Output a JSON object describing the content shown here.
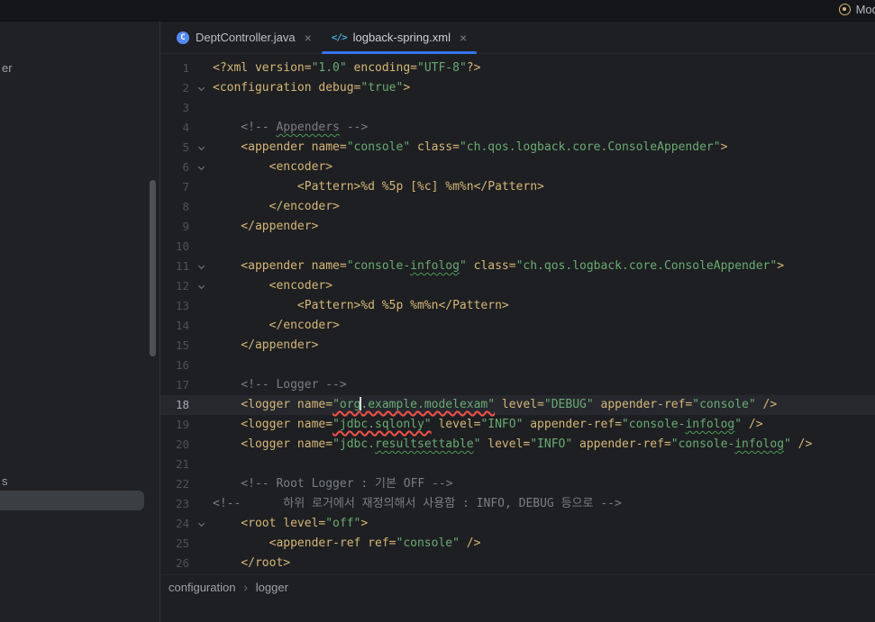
{
  "titlebar": {
    "model_label": "Model"
  },
  "tabs": [
    {
      "label": "DeptController.java",
      "icon": "java-class-icon",
      "close_label": "×",
      "active": false
    },
    {
      "label": "logback-spring.xml",
      "icon": "xml-file-icon",
      "close_label": "×",
      "active": true
    }
  ],
  "icon_glyphs": {
    "java-class-icon": "C",
    "xml-file-icon": "</>"
  },
  "sidebar": {
    "fragment_top": "er",
    "fragment_bottom": "s"
  },
  "breadcrumbs": {
    "items": [
      "configuration",
      "logger"
    ],
    "separator": "›"
  },
  "editor": {
    "lines": [
      {
        "n": 1,
        "segs": [
          [
            "t",
            "<?xml version="
          ],
          [
            "v",
            "\"1.0\""
          ],
          [
            "t",
            " encoding="
          ],
          [
            "v",
            "\"UTF-8\""
          ],
          [
            "t",
            "?>"
          ]
        ]
      },
      {
        "n": 2,
        "fold": true,
        "segs": [
          [
            "t",
            "<configuration debug="
          ],
          [
            "v",
            "\"true\""
          ],
          [
            "t",
            ">"
          ]
        ]
      },
      {
        "n": 3,
        "segs": []
      },
      {
        "n": 4,
        "segs": [
          [
            "c",
            "    <!-- "
          ],
          [
            "c typo",
            "Appenders"
          ],
          [
            "c",
            " -->"
          ]
        ]
      },
      {
        "n": 5,
        "fold": true,
        "segs": [
          [
            "t",
            "    <appender name="
          ],
          [
            "v",
            "\"console\""
          ],
          [
            "t",
            " class="
          ],
          [
            "v",
            "\"ch.qos.logback.core.ConsoleAppender\""
          ],
          [
            "t",
            ">"
          ]
        ]
      },
      {
        "n": 6,
        "fold": true,
        "segs": [
          [
            "t",
            "        <encoder>"
          ]
        ]
      },
      {
        "n": 7,
        "segs": [
          [
            "t",
            "            <Pattern>%d %5p [%c] %m%n</Pattern>"
          ]
        ]
      },
      {
        "n": 8,
        "segs": [
          [
            "t",
            "        </encoder>"
          ]
        ]
      },
      {
        "n": 9,
        "segs": [
          [
            "t",
            "    </appender>"
          ]
        ]
      },
      {
        "n": 10,
        "segs": []
      },
      {
        "n": 11,
        "fold": true,
        "segs": [
          [
            "t",
            "    <appender name="
          ],
          [
            "v",
            "\"console-"
          ],
          [
            "v typo",
            "infolog"
          ],
          [
            "v",
            "\""
          ],
          [
            "t",
            " class="
          ],
          [
            "v",
            "\"ch.qos.logback.core.ConsoleAppender\""
          ],
          [
            "t",
            ">"
          ]
        ]
      },
      {
        "n": 12,
        "fold": true,
        "segs": [
          [
            "t",
            "        <encoder>"
          ]
        ]
      },
      {
        "n": 13,
        "segs": [
          [
            "t",
            "            <Pattern>%d %5p %m%n</Pattern>"
          ]
        ]
      },
      {
        "n": 14,
        "segs": [
          [
            "t",
            "        </encoder>"
          ]
        ]
      },
      {
        "n": 15,
        "segs": [
          [
            "t",
            "    </appender>"
          ]
        ]
      },
      {
        "n": 16,
        "segs": []
      },
      {
        "n": 17,
        "segs": [
          [
            "c",
            "    <!-- Logger -->"
          ]
        ]
      },
      {
        "n": 18,
        "current": true,
        "segs": [
          [
            "t",
            "    <logger name="
          ],
          [
            "v err",
            "\"org"
          ],
          [
            "caret",
            ""
          ],
          [
            "v err",
            ".example.modelexam\""
          ],
          [
            "t",
            " level="
          ],
          [
            "v",
            "\"DEBUG\""
          ],
          [
            "t",
            " appender-ref="
          ],
          [
            "v",
            "\"console\""
          ],
          [
            "t",
            " />"
          ]
        ]
      },
      {
        "n": 19,
        "segs": [
          [
            "t",
            "    <logger name="
          ],
          [
            "v err",
            "\"jdbc.sqlonly\""
          ],
          [
            "t",
            " level="
          ],
          [
            "v",
            "\"INFO\""
          ],
          [
            "t",
            " appender-ref="
          ],
          [
            "v",
            "\"console-"
          ],
          [
            "v typo",
            "infolog"
          ],
          [
            "v",
            "\""
          ],
          [
            "t",
            " />"
          ]
        ]
      },
      {
        "n": 20,
        "segs": [
          [
            "t",
            "    <logger name="
          ],
          [
            "v",
            "\"jdbc."
          ],
          [
            "v typo",
            "resultsettable"
          ],
          [
            "v",
            "\""
          ],
          [
            "t",
            " level="
          ],
          [
            "v",
            "\"INFO\""
          ],
          [
            "t",
            " appender-ref="
          ],
          [
            "v",
            "\"console-"
          ],
          [
            "v typo",
            "infolog"
          ],
          [
            "v",
            "\""
          ],
          [
            "t",
            " />"
          ]
        ]
      },
      {
        "n": 21,
        "segs": []
      },
      {
        "n": 22,
        "segs": [
          [
            "c",
            "    <!-- Root Logger : 기본 OFF -->"
          ]
        ]
      },
      {
        "n": 23,
        "segs": [
          [
            "c",
            "<!--      하위 로거에서 재정의해서 사용함 : INFO, DEBUG 등으로 -->"
          ]
        ]
      },
      {
        "n": 24,
        "fold": true,
        "segs": [
          [
            "t",
            "    <root level="
          ],
          [
            "v",
            "\"off\""
          ],
          [
            "t",
            ">"
          ]
        ]
      },
      {
        "n": 25,
        "segs": [
          [
            "t",
            "        <appender-ref ref="
          ],
          [
            "v",
            "\"console\""
          ],
          [
            "t",
            " />"
          ]
        ]
      },
      {
        "n": 26,
        "segs": [
          [
            "t",
            "    </root>"
          ]
        ]
      }
    ]
  },
  "colors": {
    "accent": "#3574f0",
    "tag": "#d5b778",
    "value": "#6aab73",
    "comment": "#7a7e85",
    "error_underline": "#f55249",
    "typo_underline": "#4c9a55",
    "current_line": "#26282e"
  }
}
